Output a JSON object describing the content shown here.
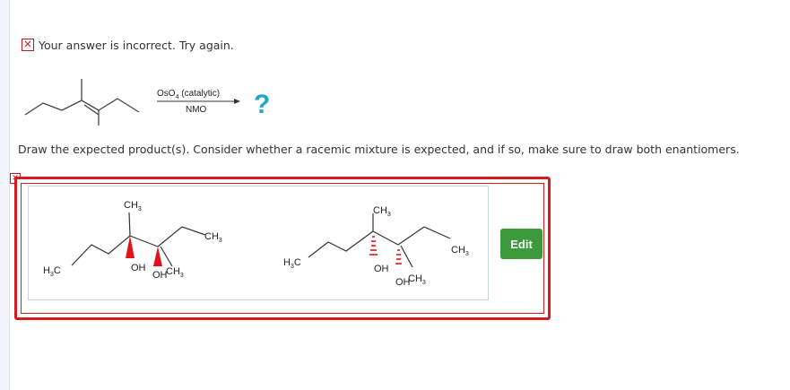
{
  "status": {
    "icon": "incorrect-x-icon",
    "message": "Your answer is incorrect.  Try again."
  },
  "reaction": {
    "reagent_os": "OsO",
    "reagent_sub": "4",
    "reagent_suffix": " (catalytic)",
    "coreagent": "NMO",
    "product": "?"
  },
  "prompt": "Draw the expected product(s). Consider whether a racemic mixture is expected, and if so, make sure to draw both enantiomers.",
  "answer": {
    "edit_label": "Edit",
    "molecule_1": {
      "ch3_top": "CH",
      "ch3_right": "CH",
      "h3c_left": "H",
      "oh_1": "OH",
      "oh_2": "OH",
      "ch3_bottom": "CH",
      "sub": "3"
    },
    "molecule_2": {
      "ch3_top": "CH",
      "ch3_right": "CH",
      "h3c_left": "H",
      "oh_1": "OH",
      "oh_2": "OH",
      "ch3_bottom": "CH",
      "sub": "3"
    }
  },
  "colors": {
    "error": "#d71920",
    "question": "#1fa9c7",
    "edit": "#3c9a3c",
    "wedge": "#e1121b"
  }
}
